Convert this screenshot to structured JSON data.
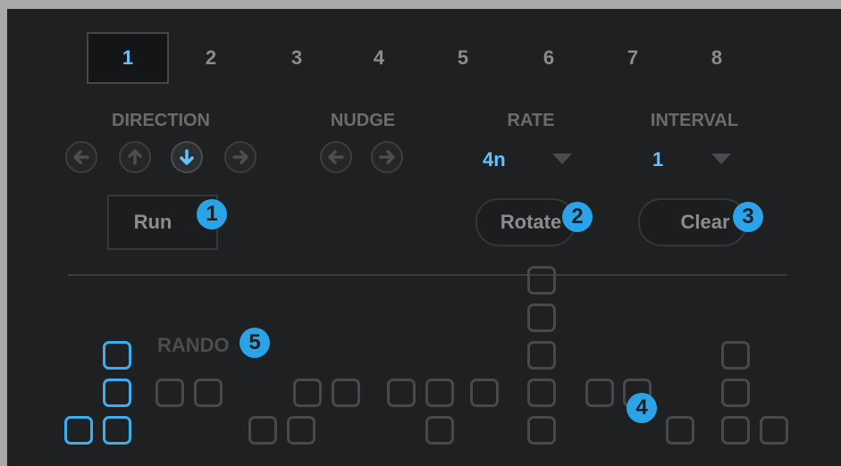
{
  "tabs": [
    "1",
    "2",
    "3",
    "4",
    "5",
    "6",
    "7",
    "8"
  ],
  "active_tab": "1",
  "direction": {
    "label": "DIRECTION",
    "active": "down",
    "icons": [
      "left-arrow-icon",
      "up-arrow-icon",
      "down-arrow-icon",
      "right-arrow-icon"
    ]
  },
  "nudge": {
    "label": "NUDGE",
    "icons": [
      "left-arrow-icon",
      "right-arrow-icon"
    ]
  },
  "rate": {
    "label": "RATE",
    "value": "4n"
  },
  "interval": {
    "label": "INTERVAL",
    "value": "1"
  },
  "buttons": {
    "run": "Run",
    "rotate": "Rotate",
    "clear": "Clear"
  },
  "badges": [
    "1",
    "2",
    "3",
    "4",
    "5"
  ],
  "random_label": "RANDO",
  "colors": {
    "accent": "#5fc3ff",
    "badge": "#2aa3e8",
    "inactive": "#48494d",
    "background": "#1f2022"
  },
  "grid": {
    "columns": [
      {
        "filled": [],
        "on": [
          0
        ]
      },
      {
        "filled": [],
        "on": [
          0,
          1,
          2
        ]
      },
      {
        "filled": [
          1
        ],
        "on": []
      },
      {
        "filled": [
          1
        ],
        "on": []
      },
      {
        "filled": [
          0
        ],
        "on": []
      },
      {
        "filled": [
          0
        ],
        "on": []
      },
      {
        "filled": [
          1
        ],
        "on": []
      },
      {
        "filled": [
          1
        ],
        "on": []
      },
      {
        "filled": [
          1
        ],
        "on": []
      },
      {
        "filled": [
          0,
          1
        ],
        "on": []
      },
      {
        "filled": [
          1
        ],
        "on": []
      },
      {
        "filled": [
          0,
          1,
          2,
          3,
          4
        ],
        "on": []
      },
      {
        "filled": [
          1
        ],
        "on": []
      },
      {
        "filled": [
          1
        ],
        "on": []
      },
      {
        "filled": [
          0
        ],
        "on": []
      },
      {
        "filled": [
          0,
          1,
          2
        ],
        "on": []
      },
      {
        "filled": [
          0
        ],
        "on": []
      }
    ]
  }
}
